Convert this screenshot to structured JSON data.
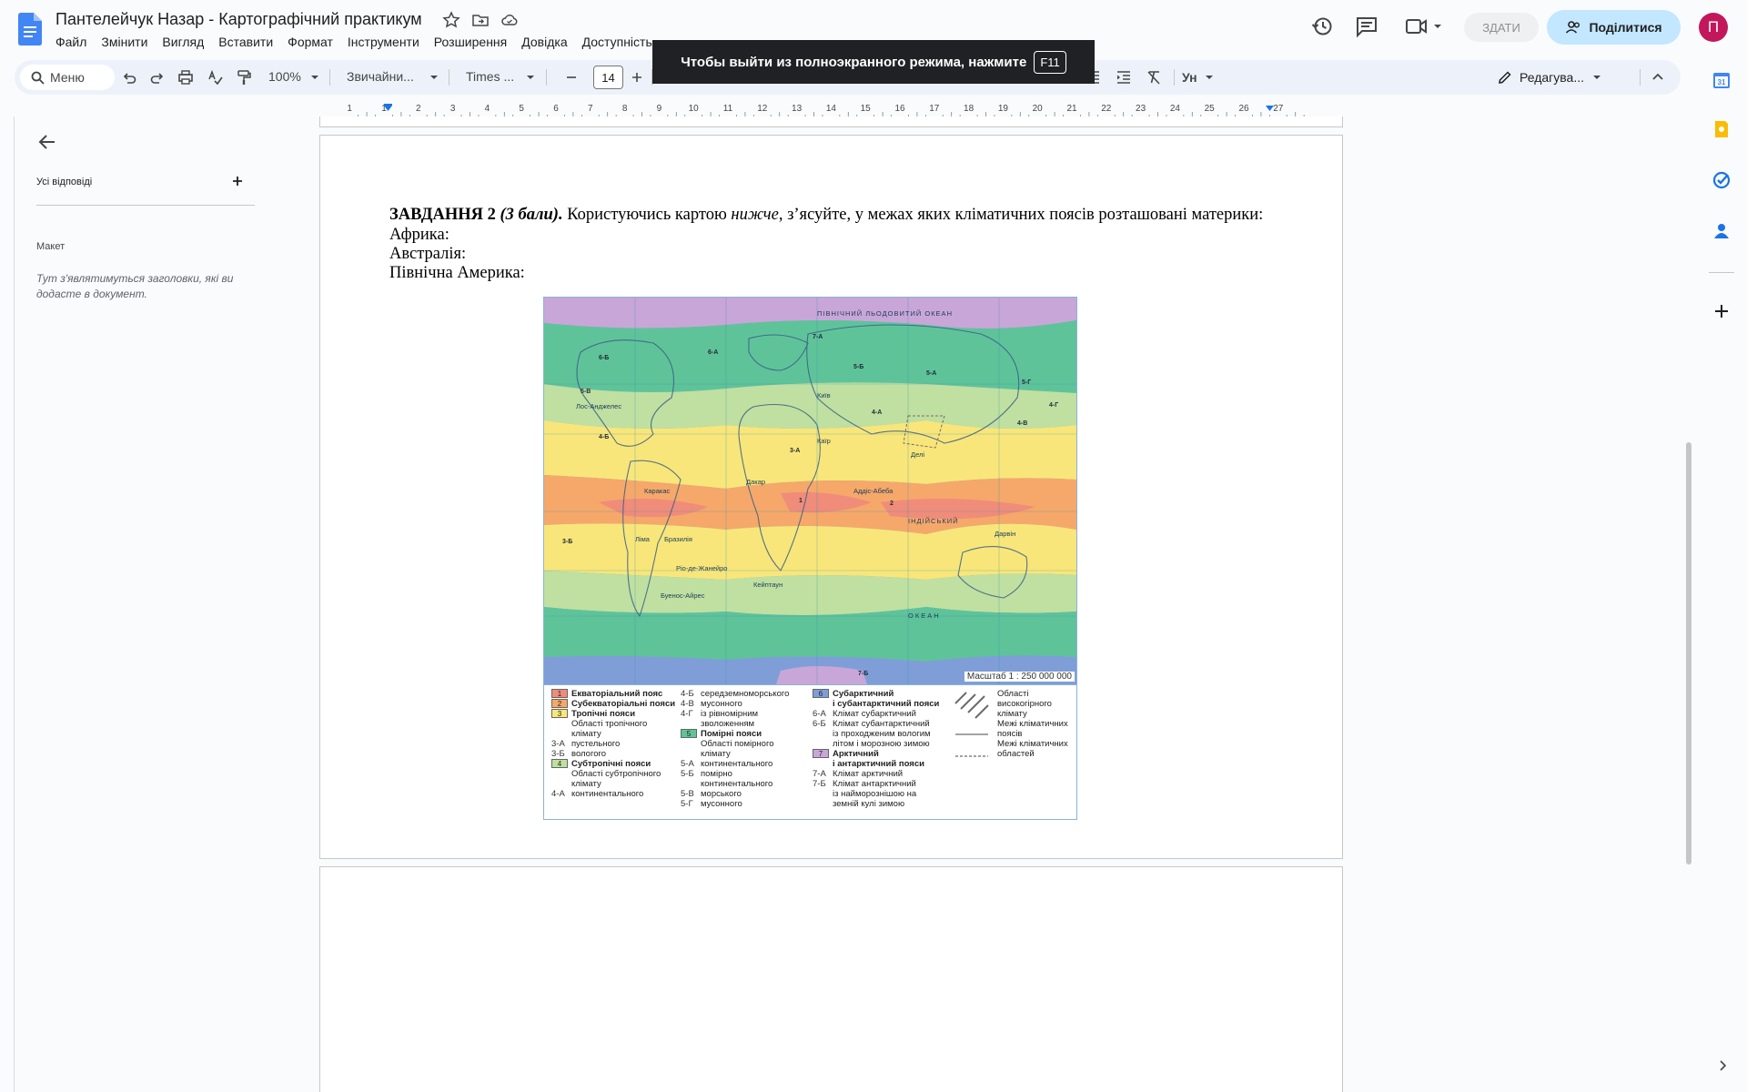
{
  "document": {
    "title": "Пантелейчук Назар - Картографічний практикум"
  },
  "menubar": [
    "Файл",
    "Змінити",
    "Вигляд",
    "Вставити",
    "Формат",
    "Інструменти",
    "Розширення",
    "Довідка",
    "Доступність"
  ],
  "header": {
    "submit_label": "ЗДАТИ",
    "share_label": "Поділитися",
    "avatar_letter": "П"
  },
  "toolbar": {
    "search_label": "Меню",
    "zoom": "100%",
    "style": "Звичайни...",
    "font": "Times ...",
    "font_size": "14",
    "edit_mode": "Редагува..."
  },
  "fullscreen_toast": {
    "text": "Чтобы выйти из полноэкранного режима, нажмите",
    "key": "F11"
  },
  "outline": {
    "all_answers": "Усі відповіді",
    "layout_heading": "Макет",
    "hint": "Тут з'являтимуться заголовки, які ви додасте в документ."
  },
  "ruler": {
    "ticks": [
      "2",
      "1",
      "1",
      "2",
      "3",
      "4",
      "5",
      "6",
      "7",
      "8",
      "9",
      "10",
      "11",
      "12",
      "13",
      "14",
      "15",
      "16",
      "17",
      "18",
      "19",
      "20",
      "21",
      "22",
      "23",
      "24",
      "25",
      "26",
      "27"
    ]
  },
  "body": {
    "task_bold": "ЗАВДАННЯ 2",
    "task_points": "(3 бали).",
    "task_text_1": " Користуючись картою ",
    "task_italic": "нижче",
    "task_text_2": ", з’ясуйте, у межах яких кліматичних поясів розташовані материки:",
    "africa": "Африка:",
    "australia": "Австралія:",
    "north_america": "Північна Америка:"
  },
  "map": {
    "scale": "Масштаб 1 : 250 000 000",
    "labels": [
      "ПІВНІЧНИЙ ЛЬОДОВИТИЙ ОКЕАН",
      "ОКЕАН",
      "ІНДІЙСЬКИЙ",
      "Лос-Анджелес",
      "Каракас",
      "Бразилія",
      "Ліма",
      "Ріо-де-Жанейро",
      "Буенос-Айрес",
      "Кейптаун",
      "Аддіс-Абеба",
      "Дакар",
      "Каїр",
      "Київ",
      "Делі",
      "Дарвін"
    ],
    "zone_codes": [
      "7-А",
      "6-Б",
      "6-А",
      "5-А",
      "5-Б",
      "5-В",
      "5-Г",
      "4-А",
      "4-Б",
      "4-В",
      "4-Г",
      "3-А",
      "3-Б",
      "2",
      "1",
      "7-Б"
    ]
  },
  "legend": {
    "col1": [
      {
        "num": "1",
        "label": "Екваторіальний пояс",
        "bold": true
      },
      {
        "num": "2",
        "label": "Субекваторіальні пояси",
        "bold": true
      },
      {
        "num": "3",
        "label": "Тропічні пояси",
        "bold": true
      },
      {
        "indent": "Області тропічного"
      },
      {
        "indent": "клімату"
      },
      {
        "code": "3-А",
        "label": "пустельного"
      },
      {
        "code": "3-Б",
        "label": "вологого"
      },
      {
        "num": "4",
        "label": "Субтропічні пояси",
        "bold": true
      },
      {
        "indent": "Області субтропічного"
      },
      {
        "indent": "клімату"
      },
      {
        "code": "4-А",
        "label": "континентального"
      }
    ],
    "col2": [
      {
        "code": "4-Б",
        "label": "середземноморського"
      },
      {
        "code": "4-В",
        "label": "мусонного"
      },
      {
        "code": "4-Г",
        "label": "із рівномірним"
      },
      {
        "indent": "зволоженням"
      },
      {
        "num": "5",
        "label": "Помірні пояси",
        "bold": true
      },
      {
        "indent": "Області помірного"
      },
      {
        "indent": "клімату"
      },
      {
        "code": "5-А",
        "label": "континентального"
      },
      {
        "code": "5-Б",
        "label": "помірно"
      },
      {
        "indent": "континентального"
      },
      {
        "code": "5-В",
        "label": "морського"
      },
      {
        "code": "5-Г",
        "label": "мусонного"
      }
    ],
    "col3": [
      {
        "num": "6",
        "label": "Субарктичний",
        "bold": true
      },
      {
        "indent": "і субантарктичний пояси",
        "bold": true
      },
      {
        "code": "6-А",
        "label": "Клімат субарктичний"
      },
      {
        "code": "6-Б",
        "label": "Клімат субантарктичний"
      },
      {
        "indent": "із проходженим вологим"
      },
      {
        "indent": "літом і морозною зимою"
      },
      {
        "num": "7",
        "label": "Арктичний",
        "bold": true
      },
      {
        "indent": "і антарктичний пояси",
        "bold": true
      },
      {
        "code": "7-А",
        "label": "Клімат арктичний"
      },
      {
        "code": "7-Б",
        "label": "Клімат антарктичний"
      },
      {
        "indent": "із найморознішою на"
      },
      {
        "indent": "земній кулі зимою"
      }
    ],
    "col4": [
      {
        "label": "Області"
      },
      {
        "label": "високогірного"
      },
      {
        "label": "клімату"
      },
      {
        "label": "Межі кліматичних"
      },
      {
        "label": "поясів"
      },
      {
        "label": "Межі кліматичних"
      },
      {
        "label": "областей"
      }
    ]
  },
  "colors": {
    "zone1": "#f08c7a",
    "zone2": "#f5a86a",
    "zone3": "#f8e67a",
    "zone4": "#bfe0a0",
    "zone5": "#5fc39a",
    "zone6": "#7f9ed8",
    "zone7": "#c9a6d8",
    "accent": "#1a73e8"
  }
}
